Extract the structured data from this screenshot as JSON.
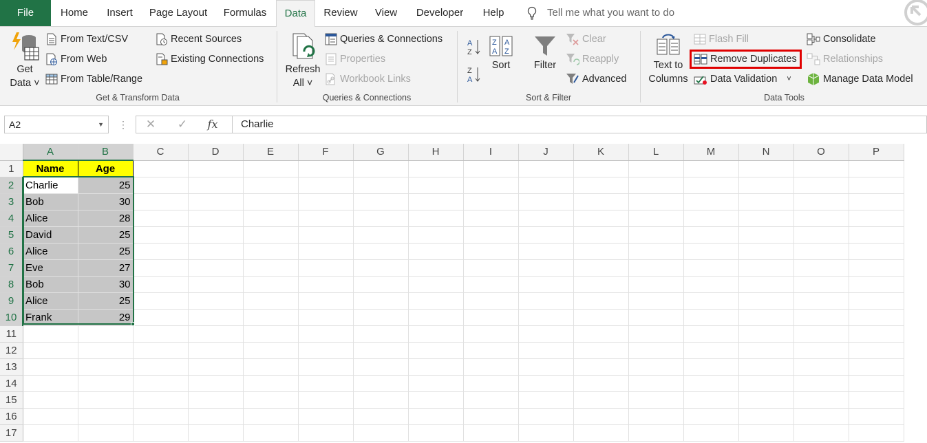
{
  "tabs": [
    "File",
    "Home",
    "Insert",
    "Page Layout",
    "Formulas",
    "Data",
    "Review",
    "View",
    "Developer",
    "Help"
  ],
  "active_tab": "Data",
  "tell_me": "Tell me what you want to do",
  "ribbon": {
    "get_transform": {
      "get_data_line1": "Get",
      "get_data_line2": "Data",
      "from_text_csv": "From Text/CSV",
      "from_web": "From Web",
      "from_table_range": "From Table/Range",
      "recent_sources": "Recent Sources",
      "existing_connections": "Existing Connections",
      "label": "Get & Transform Data"
    },
    "queries": {
      "refresh_line1": "Refresh",
      "refresh_line2": "All",
      "queries_connections": "Queries & Connections",
      "properties": "Properties",
      "workbook_links": "Workbook Links",
      "label": "Queries & Connections"
    },
    "sort_filter": {
      "sort": "Sort",
      "filter": "Filter",
      "clear": "Clear",
      "reapply": "Reapply",
      "advanced": "Advanced",
      "label": "Sort & Filter"
    },
    "data_tools": {
      "text_to_columns_line1": "Text to",
      "text_to_columns_line2": "Columns",
      "flash_fill": "Flash Fill",
      "remove_duplicates": "Remove Duplicates",
      "data_validation": "Data Validation",
      "consolidate": "Consolidate",
      "relationships": "Relationships",
      "manage_data_model": "Manage Data Model",
      "label": "Data Tools"
    }
  },
  "formula_bar": {
    "name_box": "A2",
    "fx": "fx",
    "formula": "Charlie"
  },
  "sheet": {
    "columns": [
      "A",
      "B",
      "C",
      "D",
      "E",
      "F",
      "G",
      "H",
      "I",
      "J",
      "K",
      "L",
      "M",
      "N",
      "O",
      "P"
    ],
    "rows": [
      "1",
      "2",
      "3",
      "4",
      "5",
      "6",
      "7",
      "8",
      "9",
      "10",
      "11",
      "12",
      "13",
      "14",
      "15",
      "16",
      "17"
    ],
    "header": [
      "Name",
      "Age"
    ],
    "data": [
      [
        "Charlie",
        "25"
      ],
      [
        "Bob",
        "30"
      ],
      [
        "Alice",
        "28"
      ],
      [
        "David",
        "25"
      ],
      [
        "Alice",
        "25"
      ],
      [
        "Eve",
        "27"
      ],
      [
        "Bob",
        "30"
      ],
      [
        "Alice",
        "25"
      ],
      [
        "Frank",
        "29"
      ]
    ]
  },
  "colors": {
    "excel_green": "#217346",
    "header_fill": "#ffff00",
    "highlight_box": "#e00000",
    "selection_fill": "#c6c6c6"
  }
}
